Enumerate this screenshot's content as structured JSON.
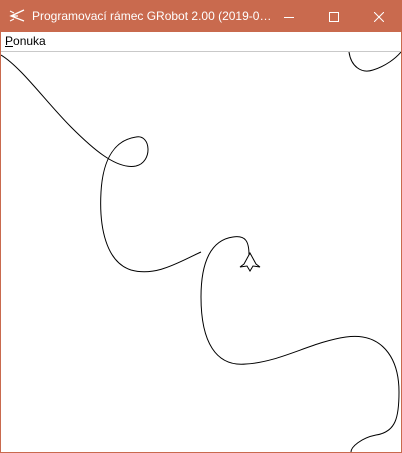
{
  "window": {
    "title": "Programovací rámec GRobot 2.00 (2019-0…",
    "accent_color": "#c96a4e"
  },
  "titlebar_buttons": {
    "minimize_icon": "minimize-icon",
    "maximize_icon": "maximize-icon",
    "close_icon": "close-icon"
  },
  "menu": {
    "items": [
      {
        "accelerator": "P",
        "rest": "onuka"
      }
    ]
  },
  "canvas": {
    "background": "#ffffff",
    "stroke_color": "#000000",
    "robot_icon": "robot-arrow-icon"
  }
}
